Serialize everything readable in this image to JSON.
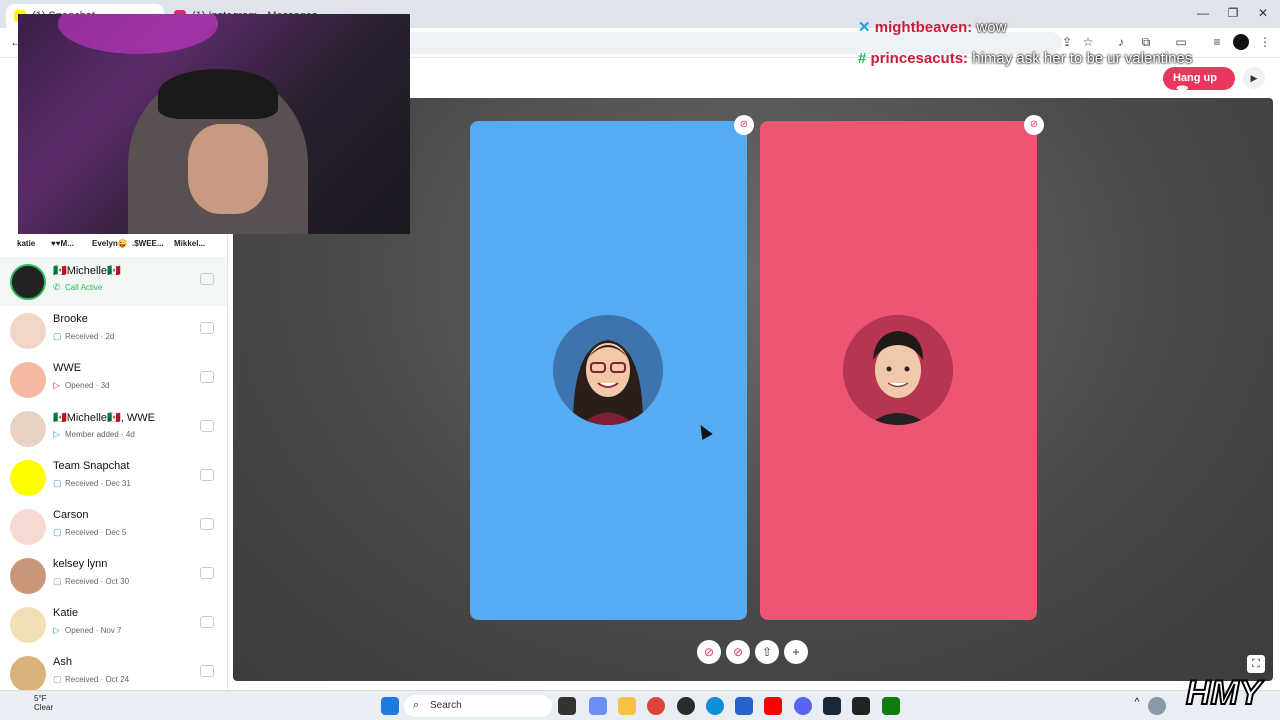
{
  "browser": {
    "tabs": [
      {
        "label": "(1) Snapchat"
      },
      {
        "label": "(1) Instagram • Messages"
      }
    ],
    "url": "",
    "window_controls": [
      "—",
      "❐",
      "✕"
    ]
  },
  "header": {
    "hangup_label": "Hang up",
    "hangup_icon": "phone-icon"
  },
  "stories": [
    "katie",
    "♥♥M...",
    "Evelyn😜",
    ".$WEE...",
    "Mikkel..."
  ],
  "chats": [
    {
      "name": "🇲🇽Michelle🇲🇽",
      "status": "Call Active",
      "icon": "phone-icon"
    },
    {
      "name": "Brooke",
      "status": "Received · 2d",
      "icon": "chat-icon"
    },
    {
      "name": "WWE",
      "status": "Opened · 3d",
      "icon": "opened-icon"
    },
    {
      "name": "🇲🇽Michelle🇲🇽, WWE",
      "status": "Member added · 4d",
      "icon": "sent-icon"
    },
    {
      "name": "Team Snapchat",
      "status": "Received · Dec 31",
      "icon": "chat-icon"
    },
    {
      "name": "Carson",
      "status": "Received · Dec 5",
      "icon": "chat-icon"
    },
    {
      "name": "kelsey lynn",
      "status": "Received · Oct 30",
      "icon": "chat-icon"
    },
    {
      "name": "Katie",
      "status": "Opened · Nov 7",
      "icon": "sent-icon"
    },
    {
      "name": "Ash",
      "status": "Received · Oct 24",
      "icon": "chat-icon"
    }
  ],
  "stream_chat": [
    {
      "user": "mightbeaven:",
      "message": "wow"
    },
    {
      "user": "princesacuts:",
      "message": "himay ask her to be ur valentines"
    }
  ],
  "taskbar": {
    "search_label": "Search",
    "weather_temp": "5°F",
    "weather_desc": "Clear"
  },
  "watermark": "HMY",
  "colors": {
    "snap_red": "#e8365d",
    "tile_left": "#55acf2",
    "tile_right": "#ee5574"
  }
}
